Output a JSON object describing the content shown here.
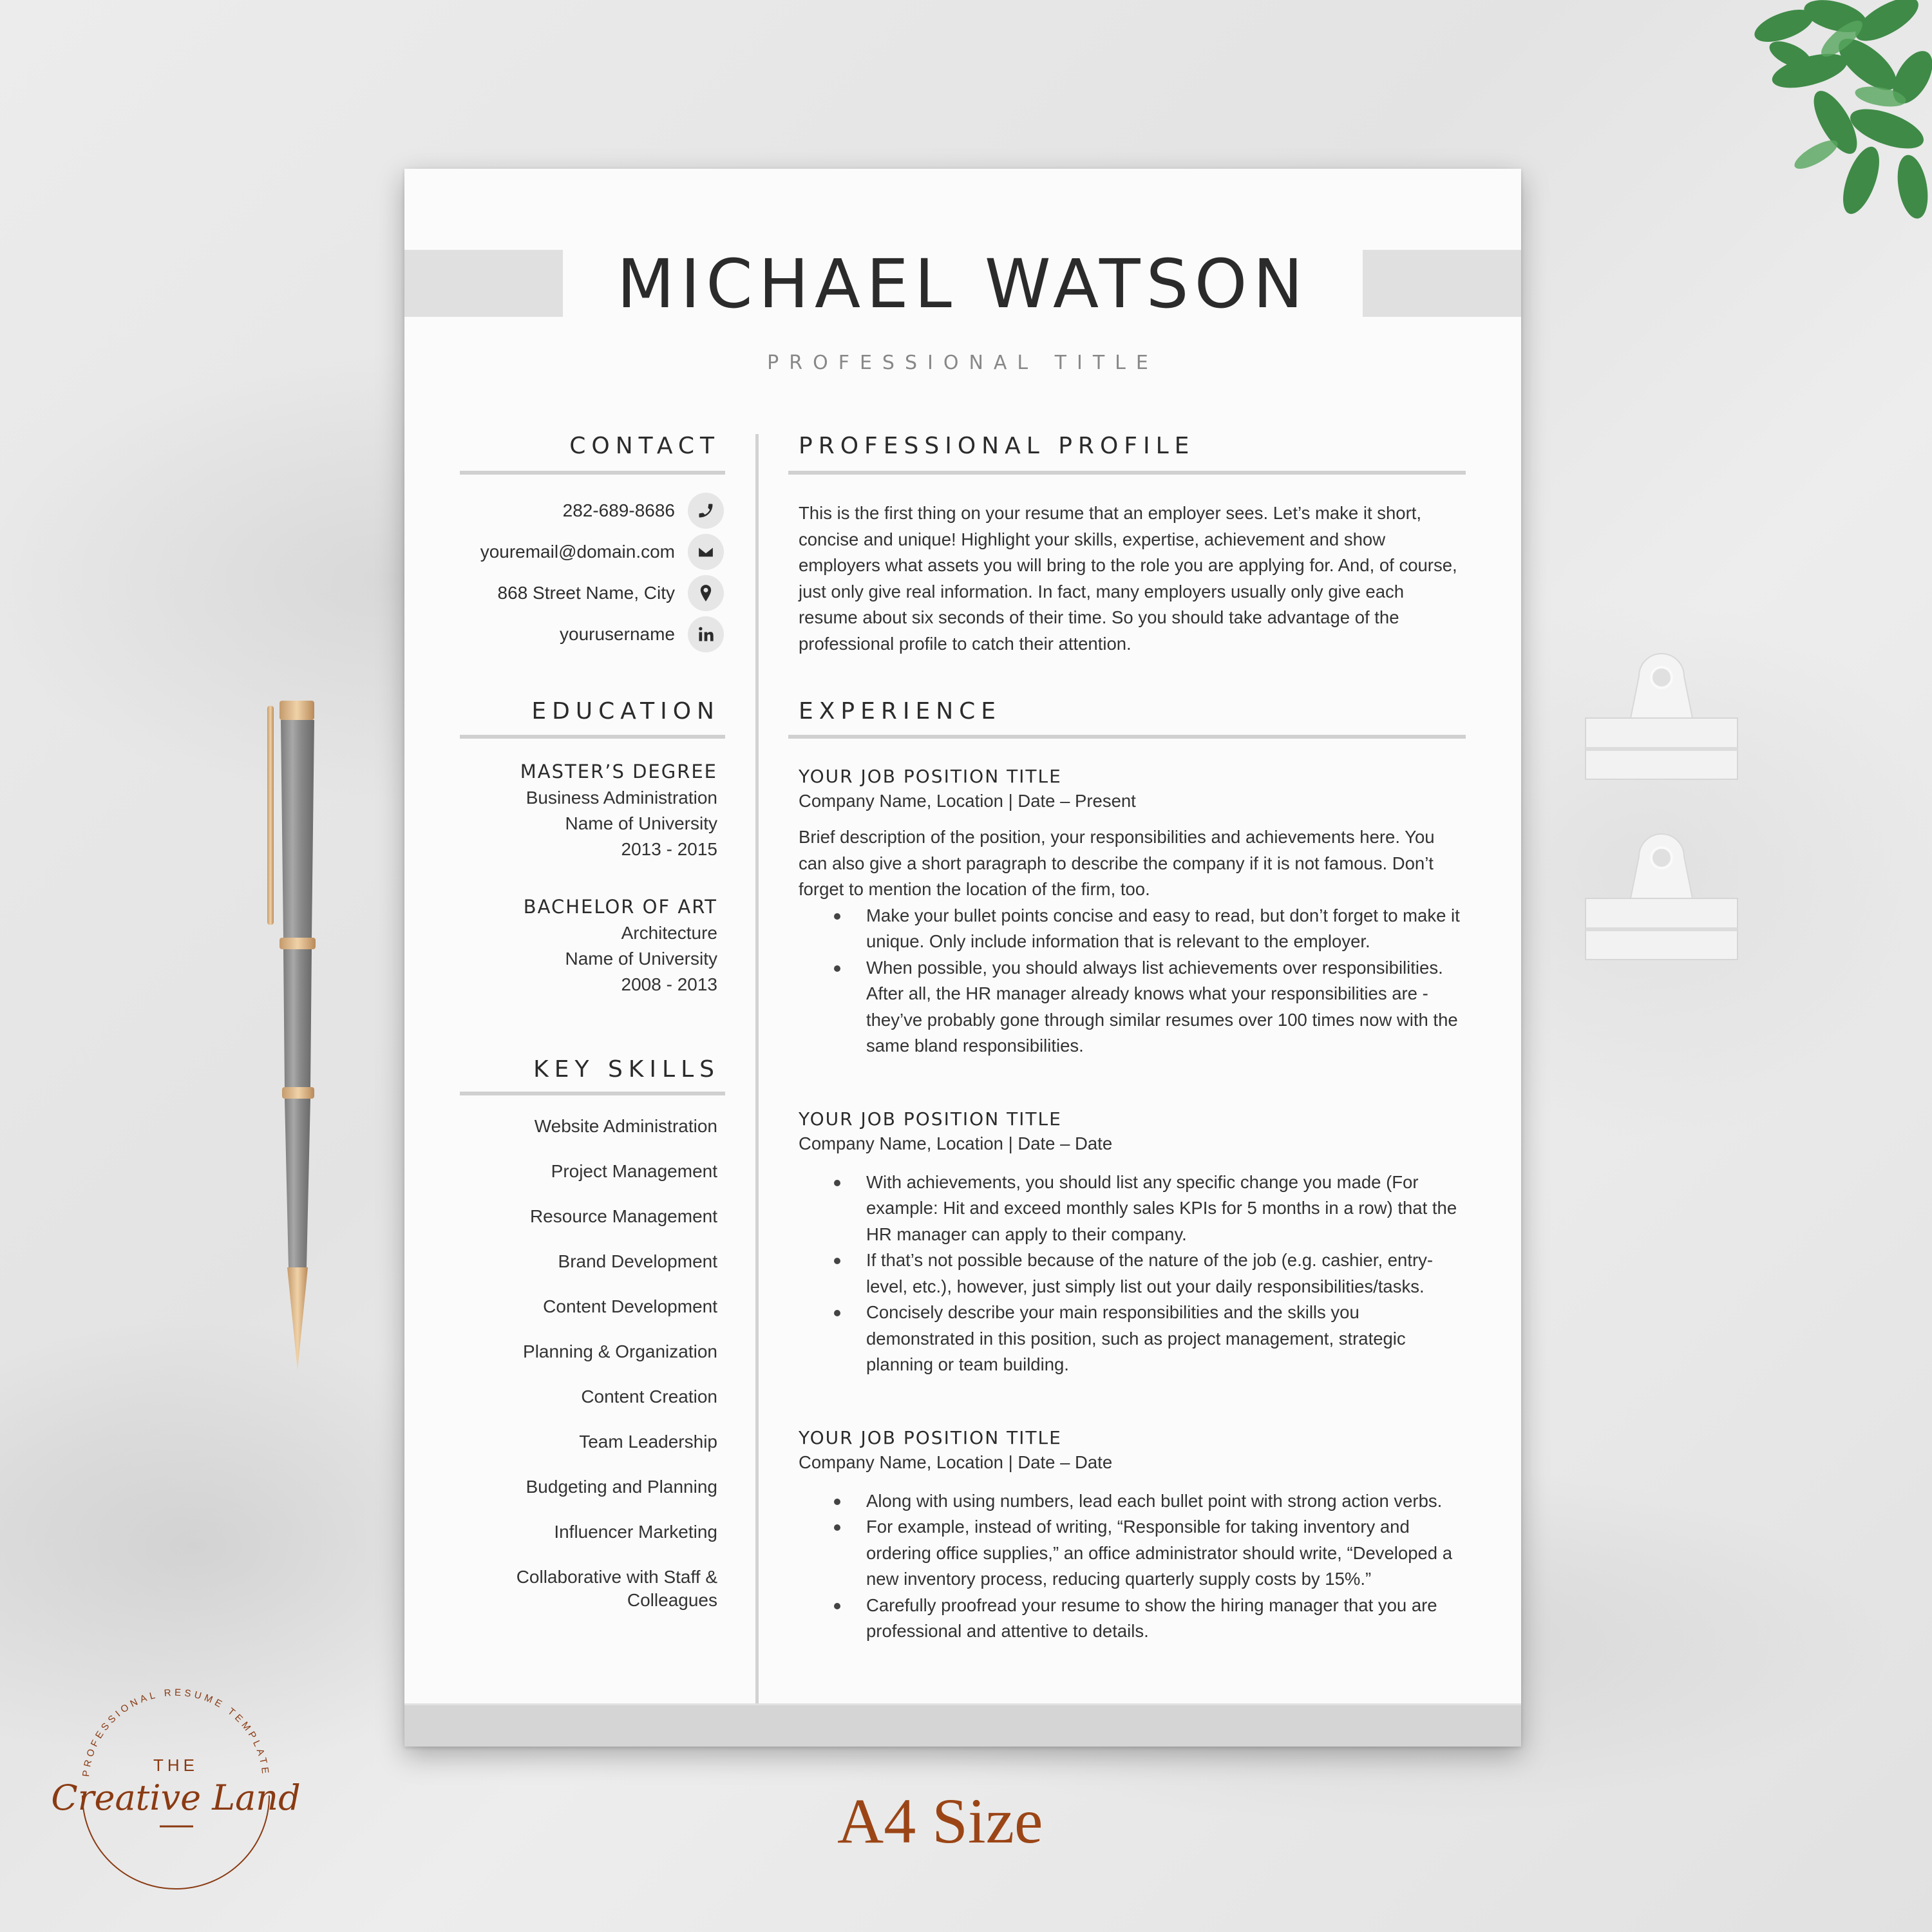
{
  "resume": {
    "name": "MICHAEL WATSON",
    "professional_title": "PROFESSIONAL TITLE",
    "contact": {
      "heading": "CONTACT",
      "items": [
        {
          "text": "282-689-8686",
          "icon": "phone-icon"
        },
        {
          "text": "youremail@domain.com",
          "icon": "envelope-icon"
        },
        {
          "text": "868 Street Name, City",
          "icon": "map-pin-icon"
        },
        {
          "text": "yourusername",
          "icon": "linkedin-icon"
        }
      ]
    },
    "education": {
      "heading": "EDUCATION",
      "entries": [
        {
          "degree": "MASTER’S DEGREE",
          "field": "Business Administration",
          "school": "Name of University",
          "years": "2013 - 2015"
        },
        {
          "degree": "BACHELOR OF ART",
          "field": "Architecture",
          "school": "Name of University",
          "years": "2008 - 2013"
        }
      ]
    },
    "skills": {
      "heading": "KEY SKILLS",
      "items": [
        "Website Administration",
        "Project Management",
        "Resource Management",
        "Brand Development",
        "Content Development",
        "Planning & Organization",
        "Content Creation",
        "Team Leadership",
        "Budgeting and Planning",
        "Influencer Marketing",
        "Collaborative with Staff & Colleagues"
      ]
    },
    "profile": {
      "heading": "PROFESSIONAL PROFILE",
      "text": "This is the first thing on your resume that an employer sees. Let’s make it short, concise and unique! Highlight your skills, expertise, achievement and show employers what assets you will bring to the role you are applying for. And, of course, just only give real information. In fact, many employers usually only give each resume about six seconds of their time. So you should take advantage of the professional profile to catch their attention."
    },
    "experience": {
      "heading": "EXPERIENCE",
      "jobs": [
        {
          "title": "YOUR JOB POSITION TITLE",
          "meta": "Company Name, Location | Date – Present",
          "description": "Brief description of the position, your responsibilities and achievements here. You can also give a short paragraph to describe the company if it is not famous. Don’t forget to mention the location of the firm, too.",
          "bullets": [
            "Make your bullet points concise and easy to read, but don’t forget to make it unique. Only include information that is relevant to the employer.",
            "When possible, you should always list achievements over responsibilities. After all, the HR manager already knows what your responsibilities are - they’ve probably gone through similar resumes over 100 times now with the same bland responsibilities."
          ]
        },
        {
          "title": "YOUR JOB POSITION TITLE",
          "meta": "Company Name, Location | Date – Date",
          "bullets": [
            "With achievements, you should list any specific change you made (For example: Hit and exceed monthly sales KPIs for 5 months in a row) that the HR manager can apply to their company.",
            "If that’s not possible because of the nature of the job (e.g. cashier, entry-level, etc.), however, just simply list out your daily responsibilities/tasks.",
            "Concisely describe your main responsibilities and the skills you demonstrated in this position, such as project management, strategic planning or team building."
          ]
        },
        {
          "title": "YOUR JOB POSITION TITLE",
          "meta": "Company Name, Location | Date – Date",
          "bullets": [
            "Along with using numbers, lead each bullet point with strong action verbs.",
            "For example, instead of writing, “Responsible for taking inventory and ordering office supplies,” an office administrator should write, “Developed a new inventory process, reducing quarterly supply costs by 15%.”",
            "Carefully proofread your resume to show the hiring manager that you are professional and attentive to details."
          ]
        }
      ]
    }
  },
  "branding": {
    "logo_arc_text": "PROFESSIONAL RESUME TEMPLATE",
    "logo_the": "THE",
    "logo_script": "Creative Land",
    "size_label": "A4 Size",
    "brand_color": "#9b4516"
  },
  "colors": {
    "accent_band": "#e0e0e0",
    "rule": "#d0d0d0",
    "text": "#2b2b2b"
  }
}
